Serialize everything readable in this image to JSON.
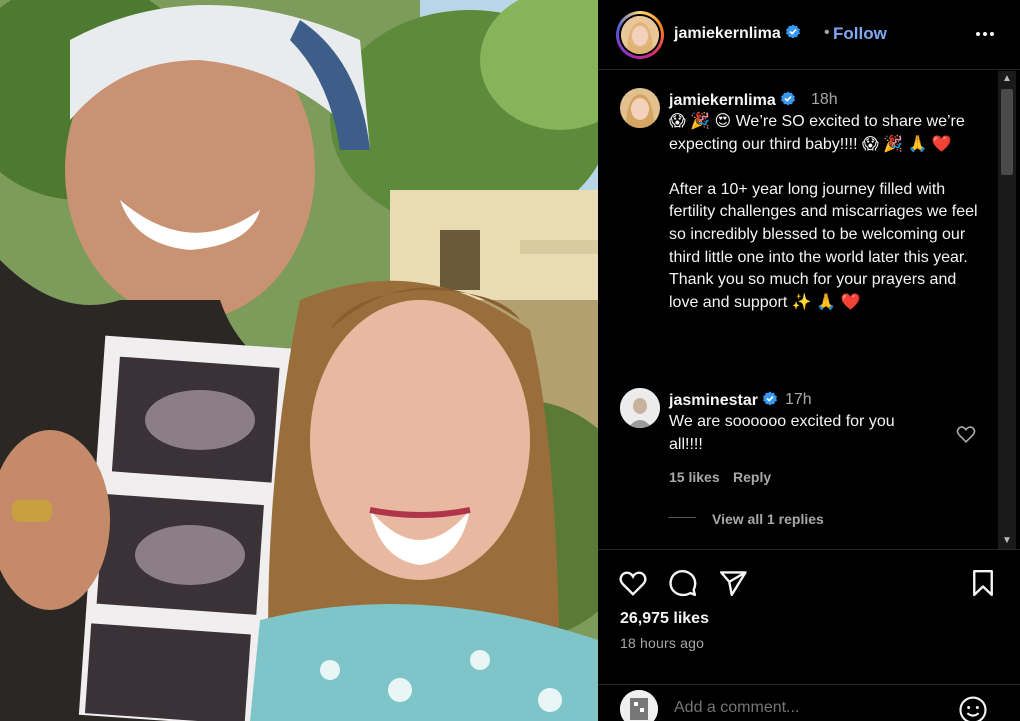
{
  "post": {
    "username": "jamiekernlima",
    "follow_label": "Follow",
    "separator": "•"
  },
  "caption": {
    "username": "jamiekernlima",
    "time": "18h",
    "text": "😱 🎉 😍 We’re SO excited to share we’re expecting our third baby!!!! 😱 🎉 🙏 ❤️\n\nAfter a 10+ year long journey filled with fertility challenges and miscarriages we feel so incredibly blessed to be welcoming our third little one into the world later this year. Thank you so much for your prayers and love and support ✨ 🙏 ❤️"
  },
  "comment": {
    "username": "jasminestar",
    "time": "17h",
    "text": "We are soooooo excited for you all!!!!",
    "likes": "15 likes",
    "reply_label": "Reply",
    "view_replies": "View all 1 replies"
  },
  "stats": {
    "likes": "26,975 likes",
    "time_ago": "18 hours ago"
  },
  "add_comment": {
    "placeholder": "Add a comment..."
  },
  "colors": {
    "accent": "#7fa8f5",
    "verified": "#3897f0",
    "background": "#000000",
    "muted_text": "#a8a8a8"
  },
  "icons": {
    "verified": "verified-badge-icon",
    "more": "more-horizontal-icon",
    "like": "heart-icon",
    "comment": "comment-bubble-icon",
    "share": "paper-plane-icon",
    "save": "bookmark-icon",
    "emoji": "emoji-smile-icon"
  }
}
